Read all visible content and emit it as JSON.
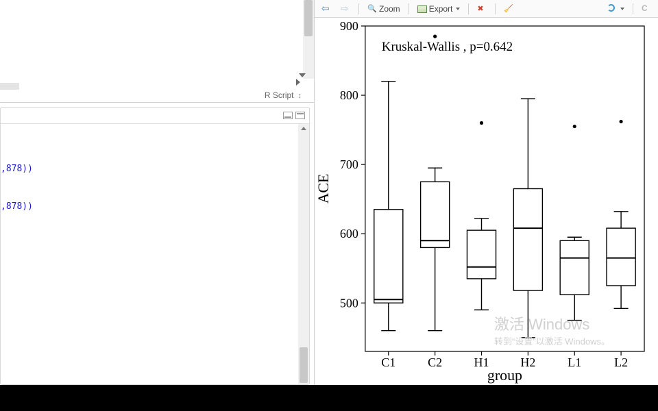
{
  "left": {
    "file_type_label": "R Script",
    "console_lines": [
      ",878))",
      "",
      ",878))"
    ]
  },
  "toolbar": {
    "back": "Back",
    "forward": "Forward",
    "zoom": "Zoom",
    "export": "Export",
    "remove": "Remove",
    "clear": "Clear All",
    "refresh": "Refresh",
    "publish": "Publish"
  },
  "watermark": {
    "line1": "激活 Windows",
    "line2": "转到“设置”以激活 Windows。"
  },
  "chart_data": {
    "type": "box",
    "xlabel": "group",
    "ylabel": "ACE",
    "annotation": "Kruskal-Wallis , p=0.642",
    "ylim": [
      430,
      900
    ],
    "yticks": [
      500,
      600,
      700,
      800,
      900
    ],
    "categories": [
      "C1",
      "C2",
      "H1",
      "H2",
      "L1",
      "L2"
    ],
    "series": [
      {
        "name": "C1",
        "min": 460,
        "q1": 500,
        "median": 505,
        "q3": 635,
        "max": 820,
        "outliers": []
      },
      {
        "name": "C2",
        "min": 460,
        "q1": 580,
        "median": 590,
        "q3": 675,
        "max": 695,
        "outliers": [
          885
        ]
      },
      {
        "name": "H1",
        "min": 490,
        "q1": 535,
        "median": 552,
        "q3": 605,
        "max": 622,
        "outliers": [
          760
        ]
      },
      {
        "name": "H2",
        "min": 450,
        "q1": 518,
        "median": 608,
        "q3": 665,
        "max": 795,
        "outliers": []
      },
      {
        "name": "L1",
        "min": 475,
        "q1": 512,
        "median": 565,
        "q3": 590,
        "max": 595,
        "outliers": [
          755
        ]
      },
      {
        "name": "L2",
        "min": 492,
        "q1": 525,
        "median": 565,
        "q3": 608,
        "max": 632,
        "outliers": [
          762
        ]
      }
    ]
  }
}
